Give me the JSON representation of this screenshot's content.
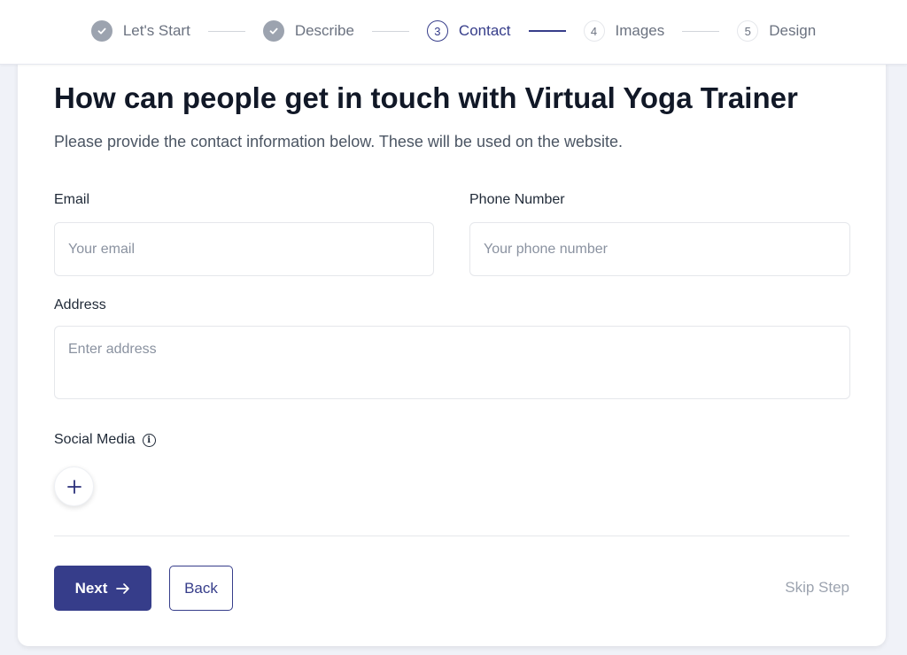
{
  "stepper": {
    "steps": [
      {
        "number": "1",
        "label": "Let's Start",
        "state": "done"
      },
      {
        "number": "2",
        "label": "Describe",
        "state": "done"
      },
      {
        "number": "3",
        "label": "Contact",
        "state": "active"
      },
      {
        "number": "4",
        "label": "Images",
        "state": "todo"
      },
      {
        "number": "5",
        "label": "Design",
        "state": "todo"
      }
    ],
    "done_icon": "check-icon"
  },
  "page": {
    "title": "How can people get in touch with Virtual Yoga Trainer",
    "subtitle": "Please provide the contact information below. These will be used on the website."
  },
  "form": {
    "email": {
      "label": "Email",
      "placeholder": "Your email",
      "value": ""
    },
    "phone": {
      "label": "Phone Number",
      "placeholder": "Your phone number",
      "value": ""
    },
    "address": {
      "label": "Address",
      "placeholder": "Enter address",
      "value": ""
    },
    "social": {
      "label": "Social Media",
      "info_icon": "info-icon",
      "add_icon": "plus-icon"
    }
  },
  "actions": {
    "next_label": "Next",
    "next_icon": "arrow-right-icon",
    "back_label": "Back",
    "skip_label": "Skip Step"
  },
  "colors": {
    "accent": "#363d8a",
    "page_bg": "#f0f2f8",
    "muted": "#9ca3af"
  }
}
